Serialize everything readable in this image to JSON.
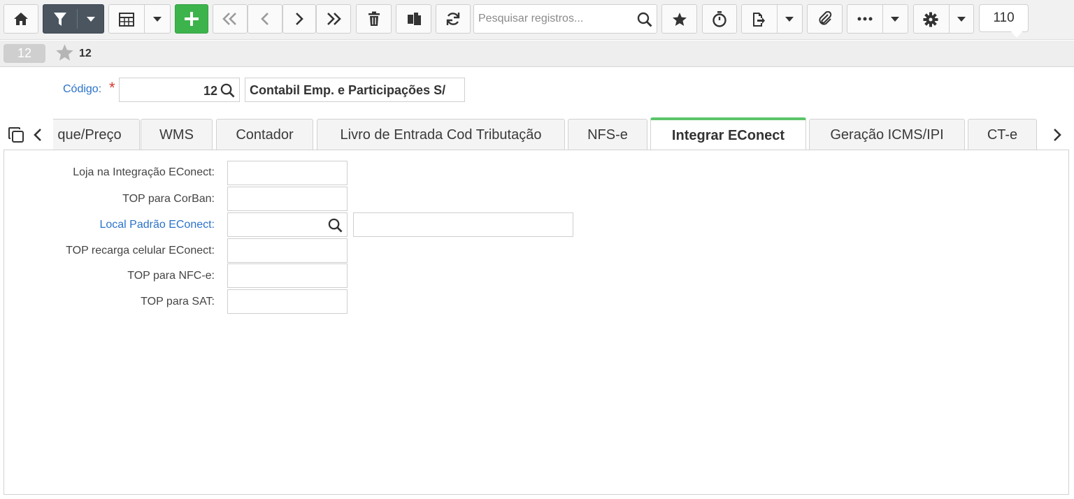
{
  "toolbar": {
    "search_placeholder": "Pesquisar registros...",
    "record_count": "110",
    "accent_color": "#3cb44b",
    "filter_color": "#4a5560",
    "icons": [
      "home-icon",
      "filter-icon",
      "grid-icon",
      "add-icon",
      "first-icon",
      "prev-icon",
      "next-icon",
      "last-icon",
      "trash-icon",
      "copy-icon",
      "refresh-icon",
      "search-icon",
      "star-icon",
      "timer-icon",
      "export-icon",
      "paperclip-icon",
      "more-icon",
      "gear-icon"
    ]
  },
  "record": {
    "badge": "12",
    "title": "12"
  },
  "header_form": {
    "code_label": "Código:",
    "required_mark": "*",
    "code_value": "12",
    "code_description": "Contabil Emp. e Participações S/"
  },
  "tabs": [
    {
      "label": "que/Preço"
    },
    {
      "label": "WMS"
    },
    {
      "label": "Contador"
    },
    {
      "label": "Livro de Entrada Cod Tributação"
    },
    {
      "label": "NFS-e"
    },
    {
      "label": "Integrar EConect",
      "active": true
    },
    {
      "label": "Geração ICMS/IPI"
    },
    {
      "label": "CT-e"
    }
  ],
  "fields": [
    {
      "label": "Loja na Integração EConect:",
      "value": ""
    },
    {
      "label": "TOP para CorBan:",
      "value": ""
    },
    {
      "label": "Local Padrão EConect:",
      "value": "",
      "description": ""
    },
    {
      "label": "TOP recarga celular EConect:",
      "value": ""
    },
    {
      "label": "TOP para NFC-e:",
      "value": ""
    },
    {
      "label": "TOP para SAT:",
      "value": ""
    }
  ]
}
